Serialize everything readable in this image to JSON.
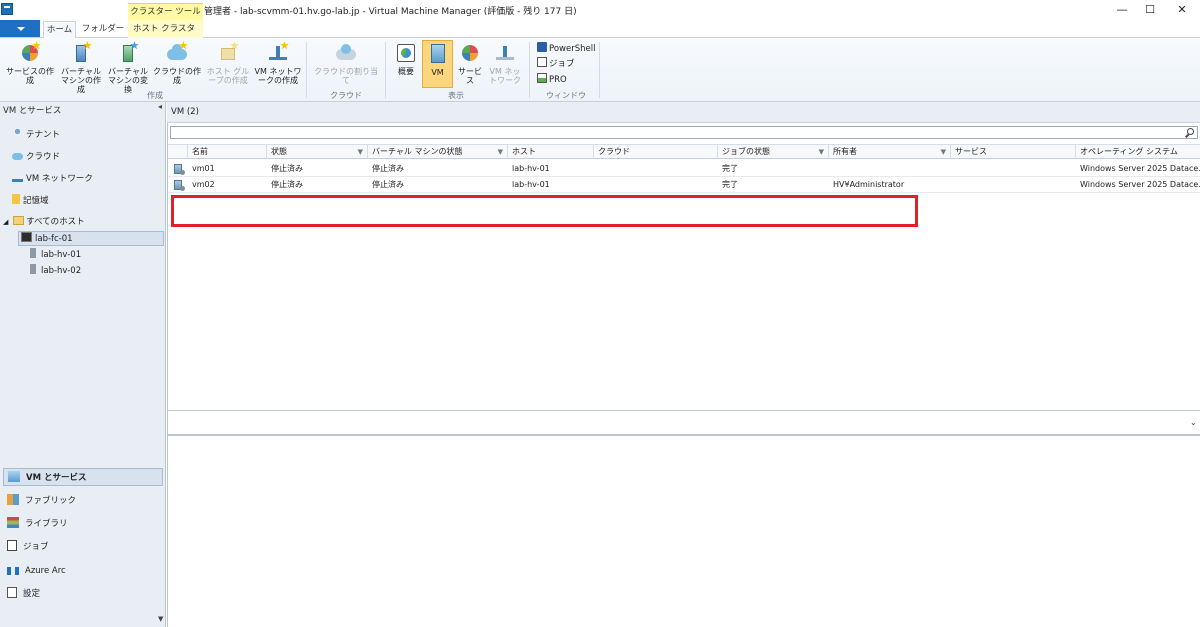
{
  "window": {
    "title": "管理者 - lab-scvmm-01.hv.go-lab.jp - Virtual Machine Manager (評価版 - 残り 177 日)",
    "context_tab_group": "クラスター ツール",
    "minimize": "—",
    "maximize": "☐",
    "close": "✕"
  },
  "ribbon": {
    "tabs": [
      "ホーム",
      "フォルダー",
      "ホスト クラスター"
    ],
    "active_tab": "ホーム",
    "groups": {
      "create": {
        "label": "作成",
        "buttons": [
          "サービスの作成",
          "バーチャル マシンの作成",
          "バーチャル マシンの変換",
          "クラウドの作成",
          "ホスト グループの作成",
          "VM ネットワークの作成"
        ]
      },
      "cloud": {
        "label": "クラウド",
        "buttons": [
          "クラウドの割り当て"
        ]
      },
      "view": {
        "label": "表示",
        "buttons": [
          "概要",
          "VM",
          "サービス",
          "VM ネットワーク"
        ]
      },
      "window": {
        "label": "ウィンドウ",
        "buttons": [
          "PowerShell",
          "ジョブ",
          "PRO"
        ]
      }
    }
  },
  "left_nav": {
    "header": "VM とサービス",
    "items": [
      "テナント",
      "クラウド",
      "VM ネットワーク",
      "記憶域"
    ],
    "tree": {
      "root": "すべてのホスト",
      "cluster": "lab-fc-01",
      "hosts": [
        "lab-hv-01",
        "lab-hv-02"
      ]
    },
    "workspaces": [
      "VM とサービス",
      "ファブリック",
      "ライブラリ",
      "ジョブ",
      "Azure Arc",
      "設定"
    ],
    "active_workspace": "VM とサービス"
  },
  "main": {
    "header": "VM (2)",
    "search": {
      "value": "",
      "placeholder": ""
    },
    "columns": [
      "名前",
      "状態",
      "バーチャル マシンの状態",
      "ホスト",
      "クラウド",
      "ジョブの状態",
      "所有者",
      "サービス",
      "オペレーティング システム"
    ],
    "rows": [
      {
        "name": "vm01",
        "status": "停止済み",
        "vm_state": "停止済み",
        "host": "lab-hv-01",
        "cloud": "",
        "job_status": "完了",
        "owner": "",
        "service": "",
        "os": "Windows Server 2025 Datace..."
      },
      {
        "name": "vm02",
        "status": "停止済み",
        "vm_state": "停止済み",
        "host": "lab-hv-01",
        "cloud": "",
        "job_status": "完了",
        "owner": "HV¥Administrator",
        "service": "",
        "os": "Windows Server 2025 Datace..."
      }
    ]
  },
  "colors": {
    "highlight": "#e0202a",
    "selected_view": "#fbd67c",
    "context_tab": "#fff9a0",
    "file_tab": "#1f6fc4"
  }
}
